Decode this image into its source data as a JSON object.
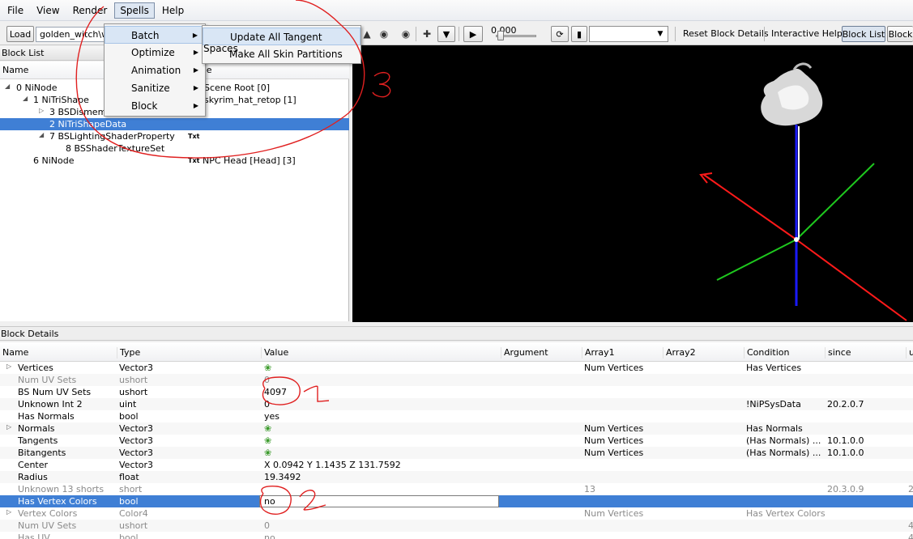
{
  "menubar": {
    "items": [
      "File",
      "View",
      "Render",
      "Spells",
      "Help"
    ]
  },
  "toolbar": {
    "load_label": "Load",
    "file_path": "golden_witch\\wit",
    "slider_value": "0.000",
    "reset_label": "Reset Block Details",
    "interactive_help_label": "Interactive Help",
    "block_list_label": "Block List",
    "block_label": "Block"
  },
  "spells_menu": {
    "items": [
      "Batch",
      "Optimize",
      "Animation",
      "Sanitize",
      "Block"
    ]
  },
  "batch_submenu": {
    "items": [
      "Update All Tangent Spaces",
      "Make All Skin Partitions"
    ]
  },
  "block_list": {
    "title": "Block List",
    "columns": [
      "Name",
      "me"
    ],
    "rows": [
      {
        "name": "0 NiNode",
        "value": "Scene Root [0]"
      },
      {
        "name": "1 NiTriShape",
        "value": "skyrim_hat_retop [1]"
      },
      {
        "name": "3 BSDismem",
        "value": ""
      },
      {
        "name": "2 NiTriShapeData",
        "value": ""
      },
      {
        "name": "7 BSLightingShaderProperty",
        "badge": "Txt",
        "value": ""
      },
      {
        "name": "8 BSShaderTextureSet",
        "value": ""
      },
      {
        "name": "6 NiNode",
        "badge": "Txt",
        "value": "NPC Head [Head] [3]"
      }
    ]
  },
  "details": {
    "title": "Block Details",
    "columns": [
      "Name",
      "Type",
      "Value",
      "Argument",
      "Array1",
      "Array2",
      "Condition",
      "since",
      "u"
    ],
    "rows": [
      {
        "name": "Vertices",
        "type": "Vector3",
        "value": "",
        "icon": true,
        "array1": "Num Vertices",
        "condition": "Has Vertices",
        "since": "",
        "u": ""
      },
      {
        "name": "Num UV Sets",
        "type": "ushort",
        "value": "0",
        "array1": "",
        "condition": "",
        "since": "",
        "u": "",
        "dim": true
      },
      {
        "name": "BS Num UV Sets",
        "type": "ushort",
        "value": "4097",
        "array1": "",
        "condition": "",
        "since": "",
        "u": ""
      },
      {
        "name": "Unknown Int 2",
        "type": "uint",
        "value": "0",
        "array1": "",
        "condition": "!NiPSysData",
        "since": "20.2.0.7",
        "u": ""
      },
      {
        "name": "Has Normals",
        "type": "bool",
        "value": "yes",
        "array1": "",
        "condition": "",
        "since": "",
        "u": ""
      },
      {
        "name": "Normals",
        "type": "Vector3",
        "value": "",
        "icon": true,
        "array1": "Num Vertices",
        "condition": "Has Normals",
        "since": "",
        "u": ""
      },
      {
        "name": "Tangents",
        "type": "Vector3",
        "value": "",
        "icon": true,
        "array1": "Num Vertices",
        "condition": "(Has Normals) ...",
        "since": "10.1.0.0",
        "u": ""
      },
      {
        "name": "Bitangents",
        "type": "Vector3",
        "value": "",
        "icon": true,
        "array1": "Num Vertices",
        "condition": "(Has Normals) ...",
        "since": "10.1.0.0",
        "u": ""
      },
      {
        "name": "Center",
        "type": "Vector3",
        "value": "X 0.0942 Y 1.1435 Z 131.7592",
        "array1": "",
        "condition": "",
        "since": "",
        "u": ""
      },
      {
        "name": "Radius",
        "type": "float",
        "value": "19.3492",
        "array1": "",
        "condition": "",
        "since": "",
        "u": ""
      },
      {
        "name": "Unknown 13 shorts",
        "type": "short",
        "value": "",
        "array1": "13",
        "condition": "",
        "since": "20.3.0.9",
        "u": "2",
        "dim": true
      },
      {
        "name": "Has Vertex Colors",
        "type": "bool",
        "value": "no",
        "array1": "",
        "condition": "",
        "since": "",
        "u": ""
      },
      {
        "name": "Vertex Colors",
        "type": "Color4",
        "value": "",
        "array1": "Num Vertices",
        "condition": "Has Vertex Colors",
        "since": "",
        "u": "",
        "dim": true
      },
      {
        "name": "Num UV Sets",
        "type": "ushort",
        "value": "0",
        "array1": "",
        "condition": "",
        "since": "",
        "u": "4",
        "dim": true
      },
      {
        "name": "Has UV",
        "type": "bool",
        "value": "no",
        "array1": "",
        "condition": "",
        "since": "",
        "u": "4",
        "dim": true
      }
    ]
  },
  "annotations": [
    "1",
    "2",
    "3"
  ],
  "colors": {
    "selection": "#3f7fd5",
    "annotation_red": "#e02020",
    "axis_red": "#ff1a1a",
    "axis_green": "#1ec81e",
    "axis_blue": "#1a1aff"
  }
}
